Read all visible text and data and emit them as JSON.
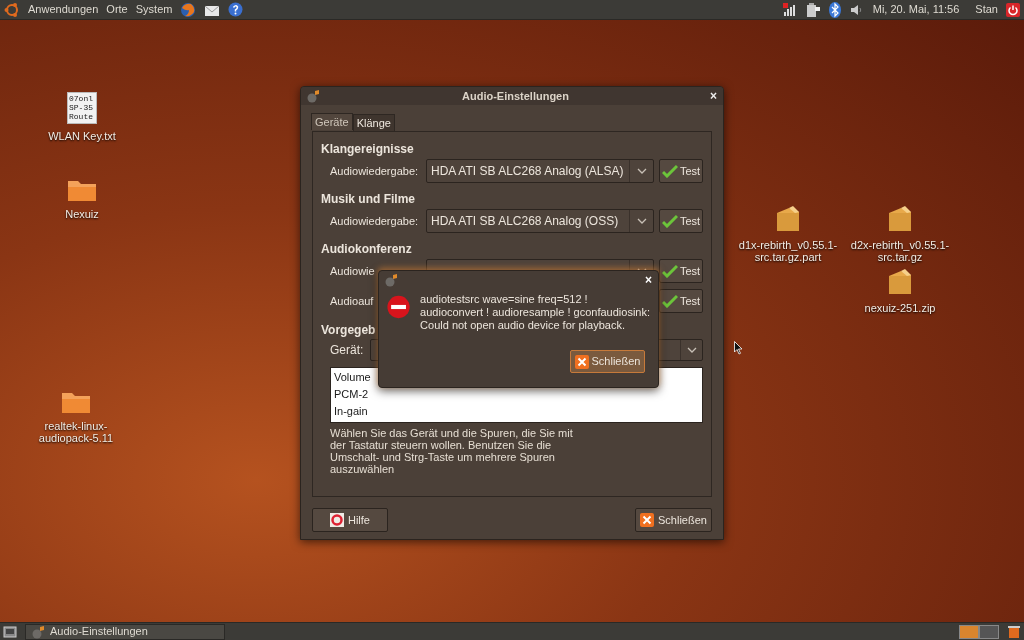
{
  "top_panel": {
    "menus": [
      "Anwendungen",
      "Orte",
      "System"
    ],
    "clock": "Mi, 20. Mai, 11:56",
    "user": "Stan"
  },
  "desktop_icons": [
    {
      "kind": "textfile",
      "lines": [
        "WLAN Key.txt"
      ],
      "preview": [
        "07onl",
        "SP-35",
        "Route"
      ]
    },
    {
      "kind": "folder",
      "lines": [
        "Nexuiz"
      ]
    },
    {
      "kind": "folder",
      "lines": [
        "realtek-linux-",
        "audiopack-5.11"
      ]
    },
    {
      "kind": "archive",
      "lines": [
        "d1x-rebirth_v0.55.1-",
        "src.tar.gz.part"
      ]
    },
    {
      "kind": "archive",
      "lines": [
        "d2x-rebirth_v0.55.1-",
        "src.tar.gz"
      ]
    },
    {
      "kind": "archive",
      "lines": [
        "nexuiz-251.zip"
      ]
    }
  ],
  "dialog": {
    "title": "Audio-Einstellungen",
    "close": "×",
    "tabs": [
      {
        "label": "Geräte",
        "selected": true
      },
      {
        "label": "Klänge",
        "selected": false
      }
    ],
    "sections": [
      {
        "heading": "Klangereignisse",
        "rows": [
          {
            "label": "Audiowiedergabe:",
            "value": "HDA ATI SB ALC268 Analog (ALSA)",
            "button": "Test"
          }
        ]
      },
      {
        "heading": "Musik und Filme",
        "rows": [
          {
            "label": "Audiowiedergabe:",
            "value": "HDA ATI SB ALC268 Analog (OSS)",
            "button": "Test"
          }
        ]
      },
      {
        "heading": "Audiokonferenz",
        "rows": [
          {
            "kind": "select",
            "label": "Audiowie",
            "button": "Test"
          },
          {
            "kind": "plain",
            "label": "Audioauf",
            "button": "Test"
          }
        ]
      }
    ],
    "mixer": {
      "heading": "Vorgegeb",
      "label": "Gerät:",
      "tracks": [
        "Volume",
        "PCM-2",
        "In-gain"
      ],
      "hint": [
        "Wählen Sie das Gerät und die Spuren, die Sie mit",
        "der Tastatur steuern wollen. Benutzen Sie die",
        "Umschalt- und Strg-Taste um mehrere Spuren",
        "auszuwählen"
      ]
    },
    "help_button": "Hilfe",
    "close_button": "Schließen"
  },
  "error_dialog": {
    "close": "×",
    "message": [
      "audiotestsrc wave=sine freq=512 !",
      "audioconvert ! audioresample ! gconfaudiosink:",
      "Could not open audio device for playback."
    ],
    "button": "Schließen"
  },
  "taskbar": {
    "items": [
      {
        "label": "Audio-Einstellungen",
        "selected": false
      }
    ]
  }
}
